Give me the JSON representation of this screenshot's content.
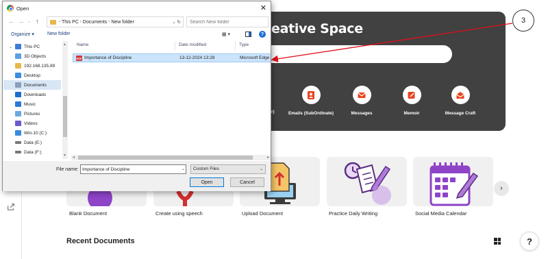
{
  "app": {
    "hero_title": "eative Space",
    "hero_partial_label": "r)",
    "hero_tools": [
      {
        "label": "Emails (SubOrdinate)",
        "icon": "contact-icon"
      },
      {
        "label": "Messages",
        "icon": "mail-icon"
      },
      {
        "label": "Memoir",
        "icon": "edit-icon"
      },
      {
        "label": "Message Craft",
        "icon": "open-mail-icon"
      }
    ],
    "cards": [
      {
        "label": "Blank Document",
        "icon": "blank-doc-icon"
      },
      {
        "label": "Create using speech",
        "icon": "microphone-icon"
      },
      {
        "label": "Upload Document",
        "icon": "upload-icon"
      },
      {
        "label": "Practice Daily Writing",
        "icon": "daily-writing-icon"
      },
      {
        "label": "Social Media Calendar",
        "icon": "calendar-icon"
      }
    ],
    "carousel_next": "›",
    "recent_title": "Recent Documents",
    "help_label": "?"
  },
  "annotation": {
    "number": "3",
    "color": "#e0101a"
  },
  "dialog": {
    "title": "Open",
    "close_glyph": "✕",
    "breadcrumb": [
      "This PC",
      "Documents",
      "New folder"
    ],
    "search_placeholder": "Search New folder",
    "toolbar": {
      "organize": "Organize ▾",
      "new_folder": "New folder",
      "help": "?"
    },
    "nav_items": [
      {
        "label": "This PC",
        "icon": "this-pc-icon",
        "color": "#3b7dd8"
      },
      {
        "label": "3D Objects",
        "icon": "3d-objects-icon",
        "color": "#5aa0e6"
      },
      {
        "label": "192.168.135.89",
        "icon": "network-drive-icon",
        "color": "#e8b84a"
      },
      {
        "label": "Desktop",
        "icon": "desktop-icon",
        "color": "#3b8ee0"
      },
      {
        "label": "Documents",
        "icon": "documents-icon",
        "color": "#8aa0b8",
        "selected": true
      },
      {
        "label": "Downloads",
        "icon": "downloads-icon",
        "color": "#1e6fd0"
      },
      {
        "label": "Music",
        "icon": "music-icon",
        "color": "#2a7ad8"
      },
      {
        "label": "Pictures",
        "icon": "pictures-icon",
        "color": "#6aa8e0"
      },
      {
        "label": "Videos",
        "icon": "videos-icon",
        "color": "#6a5acd"
      },
      {
        "label": "Win-10 (C:)",
        "icon": "windows-drive-icon",
        "color": "#3a8be0"
      },
      {
        "label": "Data (E:)",
        "icon": "drive-icon",
        "color": "#777777"
      },
      {
        "label": "Data (F:)",
        "icon": "drive-icon",
        "color": "#777777"
      }
    ],
    "columns": [
      "Name",
      "Date modified",
      "Type"
    ],
    "files": [
      {
        "name": "Importance of Discipline",
        "date": "13-12-2024 13:28",
        "type": "Microsoft Edge"
      }
    ],
    "file_name_label": "File name:",
    "file_name_value": "Importance of Discipline",
    "filter": "Custom Files",
    "open_label": "Open",
    "cancel_label": "Cancel"
  }
}
